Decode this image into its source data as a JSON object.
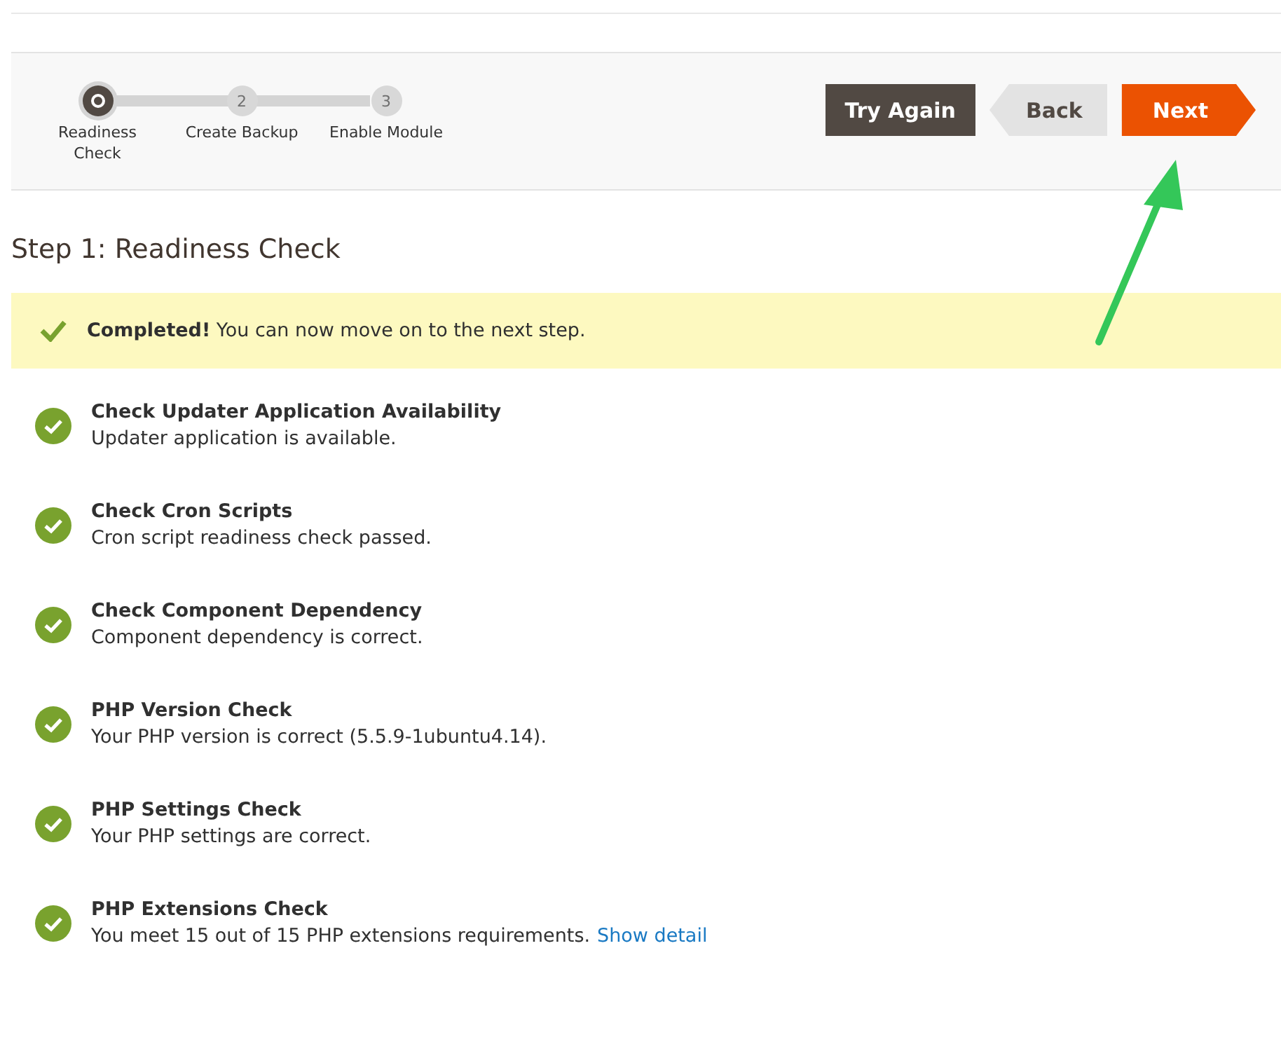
{
  "steps": [
    {
      "label": "Readiness Check",
      "selected": true
    },
    {
      "number": "2",
      "label": "Create Backup",
      "selected": false
    },
    {
      "number": "3",
      "label": "Enable Module",
      "selected": false
    }
  ],
  "buttons": [
    {
      "kind": "plain",
      "label": "Try Again"
    },
    {
      "kind": "back",
      "label": "Back"
    },
    {
      "kind": "next",
      "label": "Next"
    }
  ],
  "title": "Step 1: Readiness Check",
  "notice": {
    "strong": "Completed!",
    "text": "You can now move on to the next step."
  },
  "checks": [
    {
      "title": "Check Updater Application Availability",
      "text": "Updater application is available.",
      "passed": true
    },
    {
      "title": "Check Cron Scripts",
      "text": "Cron script readiness check passed.",
      "passed": true
    },
    {
      "title": "Check Component Dependency",
      "text": "Component dependency is correct.",
      "passed": true
    },
    {
      "title": "PHP Version Check",
      "text": "Your PHP version is correct (5.5.9-1ubuntu4.14).",
      "passed": true
    },
    {
      "title": "PHP Settings Check",
      "text": "Your PHP settings are correct.",
      "passed": true
    },
    {
      "title": "PHP Extensions Check",
      "text": "You meet 15 out of 15 PHP extensions requirements.",
      "link": "Show detail",
      "passed": true
    }
  ]
}
